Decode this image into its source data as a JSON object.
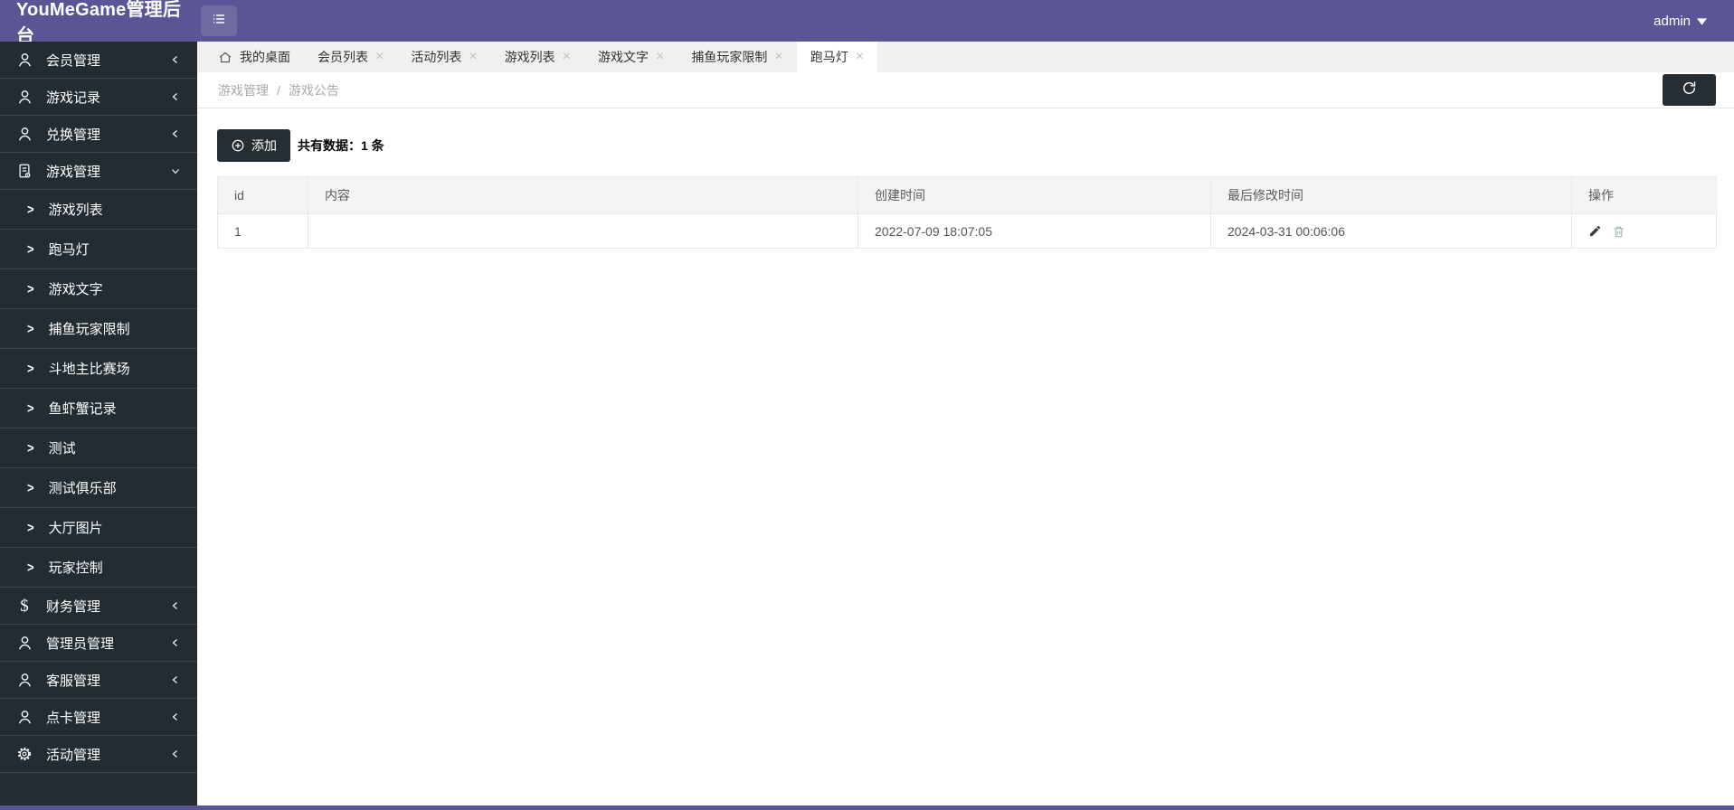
{
  "header": {
    "title": "YouMeGame管理后台",
    "user": "admin"
  },
  "tabs": [
    {
      "id": "my-desktop",
      "label": "我的桌面",
      "home": true,
      "closable": false,
      "active": false
    },
    {
      "id": "member-list",
      "label": "会员列表",
      "home": false,
      "closable": true,
      "active": false
    },
    {
      "id": "activity-list",
      "label": "活动列表",
      "home": false,
      "closable": true,
      "active": false
    },
    {
      "id": "game-list",
      "label": "游戏列表",
      "home": false,
      "closable": true,
      "active": false
    },
    {
      "id": "game-text",
      "label": "游戏文字",
      "home": false,
      "closable": true,
      "active": false
    },
    {
      "id": "fishing-player-limit",
      "label": "捕鱼玩家限制",
      "home": false,
      "closable": true,
      "active": false
    },
    {
      "id": "marquee",
      "label": "跑马灯",
      "home": false,
      "closable": true,
      "active": true
    }
  ],
  "breadcrumb": {
    "parent": "游戏管理",
    "separator": "/",
    "current": "游戏公告"
  },
  "toolbar": {
    "add_label": "添加",
    "count_text": "共有数据：1 条"
  },
  "table": {
    "columns": [
      "id",
      "内容",
      "创建时间",
      "最后修改时间",
      "操作"
    ],
    "rows": [
      {
        "id": "1",
        "content": "",
        "created": "2022-07-09 18:07:05",
        "modified": "2024-03-31 00:06:06"
      }
    ]
  },
  "sidebar": {
    "items": [
      {
        "id": "member-management",
        "label": "会员管理",
        "icon": "user",
        "expanded": false
      },
      {
        "id": "game-records",
        "label": "游戏记录",
        "icon": "user",
        "expanded": false
      },
      {
        "id": "exchange-management",
        "label": "兑换管理",
        "icon": "user",
        "expanded": false
      },
      {
        "id": "game-management",
        "label": "游戏管理",
        "icon": "file",
        "expanded": true,
        "children": [
          {
            "id": "game-list",
            "label": "游戏列表"
          },
          {
            "id": "marquee",
            "label": "跑马灯"
          },
          {
            "id": "game-text",
            "label": "游戏文字"
          },
          {
            "id": "fishing-player-limit",
            "label": "捕鱼玩家限制"
          },
          {
            "id": "landlord-arena",
            "label": "斗地主比赛场"
          },
          {
            "id": "fish-shrimp-crab",
            "label": "鱼虾蟹记录"
          },
          {
            "id": "test",
            "label": "测试"
          },
          {
            "id": "test-club",
            "label": "测试俱乐部"
          },
          {
            "id": "lobby-images",
            "label": "大厅图片"
          },
          {
            "id": "player-control",
            "label": "玩家控制"
          }
        ]
      },
      {
        "id": "finance-management",
        "label": "财务管理",
        "icon": "dollar",
        "expanded": false
      },
      {
        "id": "admin-management",
        "label": "管理员管理",
        "icon": "user",
        "expanded": false
      },
      {
        "id": "service-management",
        "label": "客服管理",
        "icon": "user",
        "expanded": false
      },
      {
        "id": "card-management",
        "label": "点卡管理",
        "icon": "user",
        "expanded": false
      },
      {
        "id": "activity-management",
        "label": "活动管理",
        "icon": "gear",
        "expanded": false
      }
    ]
  },
  "colors": {
    "header_purple": "#5a5696",
    "sidebar_dark": "#242c33",
    "button_dark": "#262d33",
    "trash_icon": "#9dbcb4",
    "pencil_icon": "#3a3a3a"
  }
}
